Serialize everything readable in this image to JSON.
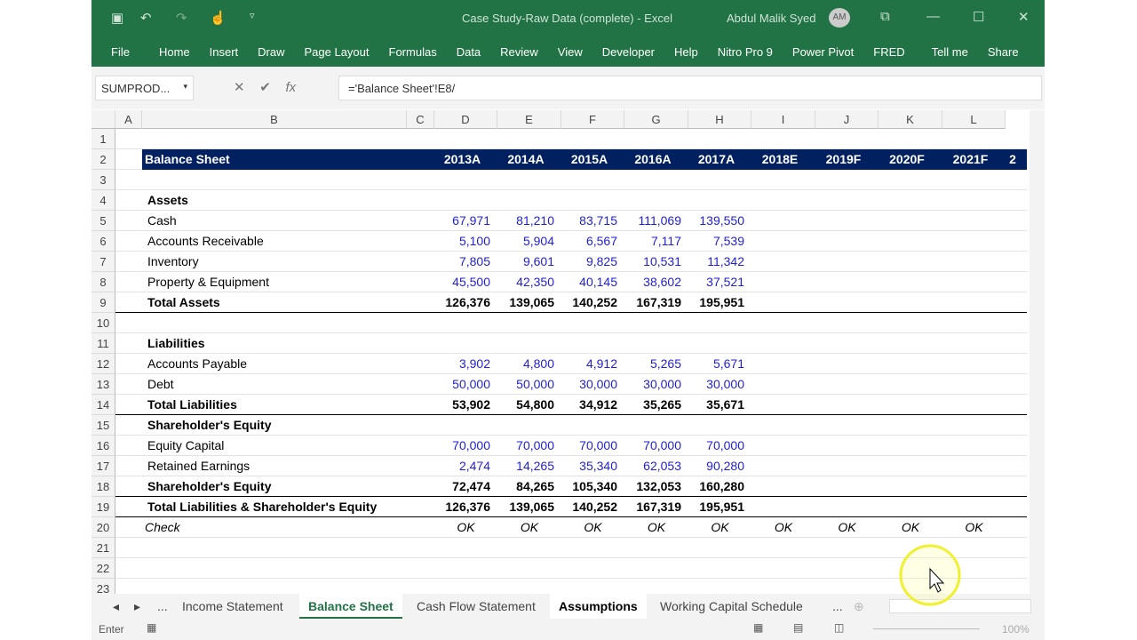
{
  "window": {
    "title": "Case Study-Raw Data (complete)  -  Excel",
    "user": "Abdul Malik Syed",
    "avatar": "AM"
  },
  "ribbon": [
    "File",
    "Home",
    "Insert",
    "Draw",
    "Page Layout",
    "Formulas",
    "Data",
    "Review",
    "View",
    "Developer",
    "Help",
    "Nitro Pro 9",
    "Power Pivot",
    "FRED",
    "Tell me",
    "Share"
  ],
  "formula_bar": {
    "name_box": "SUMPROD...",
    "formula": "='Balance Sheet'!E8/",
    "fx": "fx"
  },
  "columns": [
    "A",
    "B",
    "C",
    "D",
    "E",
    "F",
    "G",
    "H",
    "I",
    "J",
    "K",
    "L"
  ],
  "rows": [
    {
      "n": "1"
    },
    {
      "n": "2",
      "header": true,
      "label": "Balance Sheet",
      "vals": [
        "2013A",
        "2014A",
        "2015A",
        "2016A",
        "2017A",
        "2018E",
        "2019F",
        "2020F",
        "2021F",
        "2"
      ]
    },
    {
      "n": "3"
    },
    {
      "n": "4",
      "label": "Assets",
      "bold": true
    },
    {
      "n": "5",
      "label": "Cash",
      "vals": [
        "67,971",
        "81,210",
        "83,715",
        "111,069",
        "139,550"
      ],
      "blue": true
    },
    {
      "n": "6",
      "label": "Accounts Receivable",
      "vals": [
        "5,100",
        "5,904",
        "6,567",
        "7,117",
        "7,539"
      ],
      "blue": true
    },
    {
      "n": "7",
      "label": "Inventory",
      "vals": [
        "7,805",
        "9,601",
        "9,825",
        "10,531",
        "11,342"
      ],
      "blue": true
    },
    {
      "n": "8",
      "label": "Property & Equipment",
      "vals": [
        "45,500",
        "42,350",
        "40,145",
        "38,602",
        "37,521"
      ],
      "blue": true
    },
    {
      "n": "9",
      "label": "Total Assets",
      "bold": true,
      "total": true,
      "vals": [
        "126,376",
        "139,065",
        "140,252",
        "167,319",
        "195,951"
      ]
    },
    {
      "n": "10"
    },
    {
      "n": "11",
      "label": "Liabilities",
      "bold": true
    },
    {
      "n": "12",
      "label": "Accounts Payable",
      "vals": [
        "3,902",
        "4,800",
        "4,912",
        "5,265",
        "5,671"
      ],
      "blue": true
    },
    {
      "n": "13",
      "label": "Debt",
      "vals": [
        "50,000",
        "50,000",
        "30,000",
        "30,000",
        "30,000"
      ],
      "blue": true
    },
    {
      "n": "14",
      "label": "Total Liabilities",
      "bold": true,
      "total": true,
      "vals": [
        "53,902",
        "54,800",
        "34,912",
        "35,265",
        "35,671"
      ]
    },
    {
      "n": "15",
      "label": "Shareholder's Equity",
      "bold": true
    },
    {
      "n": "16",
      "label": "Equity Capital",
      "vals": [
        "70,000",
        "70,000",
        "70,000",
        "70,000",
        "70,000"
      ],
      "blue": true
    },
    {
      "n": "17",
      "label": "Retained Earnings",
      "vals": [
        "2,474",
        "14,265",
        "35,340",
        "62,053",
        "90,280"
      ],
      "blue": true
    },
    {
      "n": "18",
      "label": "Shareholder's Equity",
      "bold": true,
      "total": true,
      "vals": [
        "72,474",
        "84,265",
        "105,340",
        "132,053",
        "160,280"
      ]
    },
    {
      "n": "19",
      "label": "Total Liabilities & Shareholder's Equity",
      "bold": true,
      "total": true,
      "vals": [
        "126,376",
        "139,065",
        "140,252",
        "167,319",
        "195,951"
      ]
    },
    {
      "n": "20",
      "label": "Check",
      "italic": true,
      "check": true,
      "vals": [
        "OK",
        "OK",
        "OK",
        "OK",
        "OK",
        "OK",
        "OK",
        "OK",
        "OK"
      ]
    },
    {
      "n": "21"
    },
    {
      "n": "22"
    },
    {
      "n": "23"
    }
  ],
  "sheet_tabs": [
    "Income Statement",
    "Balance Sheet",
    "Cash Flow Statement",
    "Assumptions",
    "Working Capital Schedule"
  ],
  "active_tab": "Balance Sheet",
  "status": {
    "mode": "Enter",
    "zoom": "100%"
  }
}
